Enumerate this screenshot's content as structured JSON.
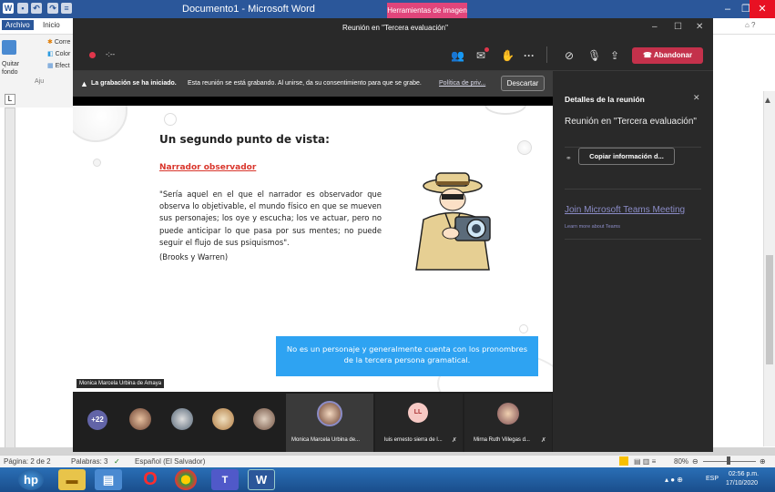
{
  "word": {
    "title": "Documento1 - Microsoft Word",
    "picture_tools": "Herramientas de imagen",
    "tabs": [
      "Archivo",
      "Inicio"
    ],
    "ribbon": {
      "remove_bg": "Quitar fondo",
      "corr": "Corre",
      "color": "Color",
      "effects": "Efect",
      "adjust": "Aju"
    },
    "status": {
      "page": "Página: 2 de 2",
      "words": "Palabras: 3",
      "language": "Español (El Salvador)",
      "zoom": "80%"
    }
  },
  "teams": {
    "window_title": "Reunión en \"Tercera evaluación\"",
    "timer": "-:--",
    "leave_label": "Abandonar",
    "recording_banner": {
      "bold": "La grabación se ha iniciado.",
      "text": "Esta reunión se está grabando. Al unirse, da su consentimiento para que se grabe.",
      "link": "Política de priv...",
      "dismiss": "Descartar"
    },
    "presenter_name": "Monica Marcela Urbina de Amaya",
    "slide": {
      "heading": "Un segundo punto de vista:",
      "subheading": "Narrador observador",
      "quote": "\"Sería aquel en el que el narrador es observador que observa lo objetivable, el mundo físico en que se mueven sus personajes; los oye y escucha; los ve actuar, pero no puede anticipar lo que pasa por sus mentes; no puede seguir el flujo de sus psiquismos\".",
      "citation": "(Brooks y Warren)",
      "callout": "No es un personaje y generalmente cuenta con los pronombres de la tercera persona gramatical."
    },
    "participants": {
      "overflow": "+22",
      "tiles": [
        {
          "name": "Monica Marcela Urbina de...",
          "initials": ""
        },
        {
          "name": "luis ernesto sierra de l...",
          "initials": "LL"
        },
        {
          "name": "Mirna Ruth Villegas d...",
          "initials": ""
        }
      ]
    },
    "details": {
      "title": "Detalles de la reunión",
      "meeting_name": "Reunión en \"Tercera evaluación\"",
      "copy_button": "Copiar información d...",
      "join_link": "Join Microsoft Teams Meeting",
      "learn_more": "Learn more about Teams"
    }
  },
  "taskbar": {
    "language": "ESP",
    "time": "02:56 p.m.",
    "date": "17/10/2020"
  },
  "colors": {
    "word_blue": "#2b579a",
    "teams_dark": "#292929",
    "leave_red": "#c4314b",
    "accent_purple": "#6264a7",
    "callout_blue": "#2ea3f2"
  }
}
